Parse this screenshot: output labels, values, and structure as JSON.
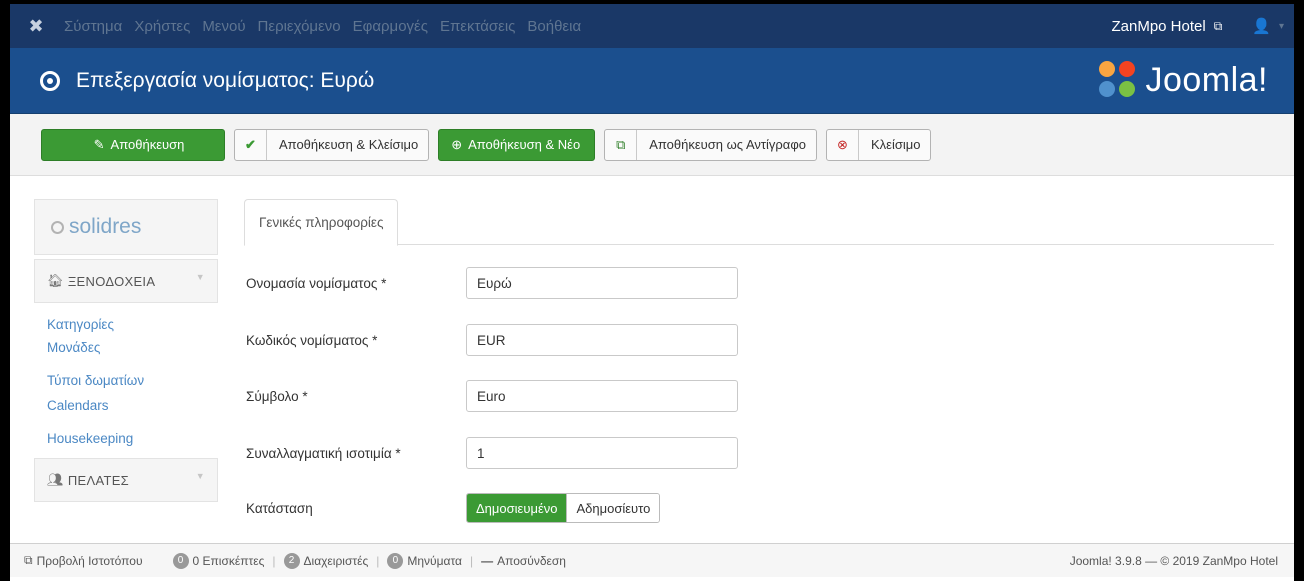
{
  "topnav": {
    "logo_icon": "joomla-icon",
    "menu": [
      "Σύστημα",
      "Χρήστες",
      "Μενού",
      "Περιεχόμενο",
      "Εφαρμογές",
      "Επεκτάσεις",
      "Βοήθεια"
    ],
    "site_name": "ZanMpo Hotel",
    "site_link_icon": "external-link-icon",
    "user_icon": "user-icon"
  },
  "titlebar": {
    "icon": "circle-dot-icon",
    "title": "Επεξεργασία νομίσματος: Ευρώ",
    "brand": "Joomla!"
  },
  "toolbar": {
    "save": {
      "label": "Αποθήκευση",
      "icon": "edit-icon"
    },
    "save_close": {
      "label": "Αποθήκευση & Κλείσιμο",
      "icon": "check-icon"
    },
    "save_new": {
      "label": "Αποθήκευση & Νέο",
      "icon": "plus-circle-icon"
    },
    "save_copy": {
      "label": "Αποθήκευση ως Αντίγραφο",
      "icon": "copy-icon"
    },
    "close": {
      "label": "Κλείσιμο",
      "icon": "close-circle-icon"
    }
  },
  "sidebar": {
    "logo_text": "solidres",
    "sections": [
      {
        "label": "ΞΕΝΟΔΟΧΕΙΑ",
        "icon": "home-icon",
        "items": [
          "Κατηγορίες",
          "Μονάδες",
          "Τύποι δωματίων",
          "Calendars",
          "Housekeeping"
        ]
      },
      {
        "label": "ΠΕΛΑΤΕΣ",
        "icon": "users-icon",
        "items": []
      }
    ]
  },
  "main": {
    "tab": "Γενικές πληροφορίες",
    "fields": {
      "currency_name": {
        "label": "Ονομασία νομίσματος *",
        "value": "Ευρώ"
      },
      "currency_code": {
        "label": "Κωδικός νομίσματος *",
        "value": "EUR"
      },
      "symbol": {
        "label": "Σύμβολο *",
        "value": "Euro"
      },
      "exchange_rate": {
        "label": "Συναλλαγματική ισοτιμία *",
        "value": "1"
      },
      "status": {
        "label": "Κατάσταση",
        "options": [
          "Δημοσιευμένο",
          "Αδημοσίευτο"
        ],
        "selected": "Δημοσιευμένο"
      }
    }
  },
  "statusbar": {
    "view_site": "Προβολή Ιστοτόπου",
    "visitors": {
      "count": "0",
      "label": "0 Επισκέπτες"
    },
    "admins": {
      "count": "2",
      "label": "Διαχειριστές"
    },
    "messages": {
      "count": "0",
      "label": "Μηνύματα"
    },
    "logout": "Αποσύνδεση",
    "version": "Joomla! 3.9.8 — © 2019 ZanMpo Hotel"
  },
  "colors": {
    "topnav_bg": "#1a3867",
    "titlebar_bg": "#1b4f8e",
    "success": "#3b9a34",
    "link": "#4b88c4"
  }
}
